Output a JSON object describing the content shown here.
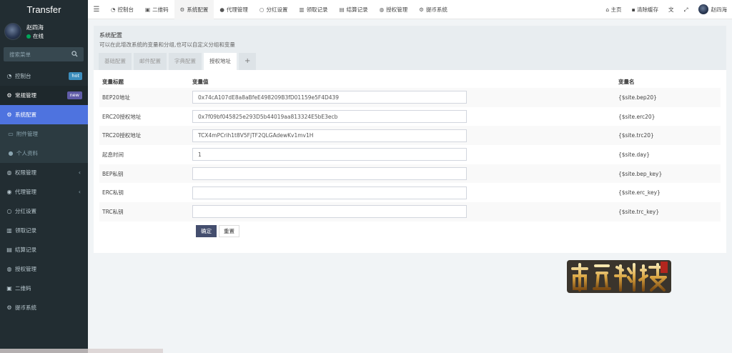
{
  "brand": "Transfer",
  "user": {
    "name": "赵四海",
    "status": "在线"
  },
  "search": {
    "placeholder": "搜索菜单"
  },
  "sidebar": {
    "items": [
      {
        "label": "控制台",
        "icon": "dashboard-icon",
        "badge": "hot"
      },
      {
        "label": "常规管理",
        "icon": "cogs-icon",
        "badge": "new"
      },
      {
        "label": "系统配置",
        "icon": "gear-icon"
      },
      {
        "label": "附件管理",
        "icon": "file-icon"
      },
      {
        "label": "个人资料",
        "icon": "user-icon"
      },
      {
        "label": "权限管理",
        "icon": "group-icon"
      },
      {
        "label": "代理管理",
        "icon": "user-circle-icon"
      },
      {
        "label": "分红设置",
        "icon": "circle-icon"
      },
      {
        "label": "领取记录",
        "icon": "bank-icon"
      },
      {
        "label": "结算记录",
        "icon": "list-icon"
      },
      {
        "label": "授权管理",
        "icon": "users-icon"
      },
      {
        "label": "二维码",
        "icon": "qrcode-icon"
      },
      {
        "label": "提币系统",
        "icon": "coin-icon"
      }
    ]
  },
  "topnav": [
    {
      "label": "控制台",
      "icon": "dashboard-icon"
    },
    {
      "label": "二维码",
      "icon": "qrcode-icon"
    },
    {
      "label": "系统配置",
      "icon": "gear-icon"
    },
    {
      "label": "代理管理",
      "icon": "user-icon"
    },
    {
      "label": "分红设置",
      "icon": "circle-icon"
    },
    {
      "label": "领取记录",
      "icon": "bank-icon"
    },
    {
      "label": "结算记录",
      "icon": "list-icon"
    },
    {
      "label": "授权管理",
      "icon": "users-icon"
    },
    {
      "label": "提币系统",
      "icon": "coin-icon"
    }
  ],
  "topright": {
    "home": "主页",
    "clear_cache": "清除缓存",
    "user": "赵四海"
  },
  "panel": {
    "title": "系统配置",
    "subtitle": "可以在此增改系统的变量和分组,也可以自定义分组和变量",
    "tabs": [
      "基础配置",
      "邮件配置",
      "字典配置",
      "授权地址"
    ],
    "add_tab": "+"
  },
  "table": {
    "headers": [
      "变量标题",
      "变量值",
      "变量名"
    ],
    "rows": [
      {
        "title": "BEP20地址",
        "value": "0x74cA107dE8a8aBfeE498209B3fD01159e5F4D439",
        "name": "{$site.bep20}"
      },
      {
        "title": "ERC20授权地址",
        "value": "0x7f09bf045825e293D5b44019aa813324E5bE3ecb",
        "name": "{$site.erc20}"
      },
      {
        "title": "TRC20授权地址",
        "value": "TCX4mPCrih1t8V5FjTF2QLGAdewKv1mv1H",
        "name": "{$site.trc20}"
      },
      {
        "title": "起息时间",
        "value": "1",
        "name": "{$site.day}"
      },
      {
        "title": "BEP私钥",
        "value": "",
        "name": "{$site.bep_key}"
      },
      {
        "title": "ERC私钥",
        "value": "",
        "name": "{$site.erc_key}"
      },
      {
        "title": "TRC私钥",
        "value": "",
        "name": "{$site.trc_key}"
      }
    ]
  },
  "buttons": {
    "confirm": "确定",
    "reset": "重置"
  },
  "logo_text": "南亚科技",
  "colors": {
    "sidebar_bg": "#222d32",
    "active": "#4e73df",
    "primary_btn": "#444e6e"
  }
}
